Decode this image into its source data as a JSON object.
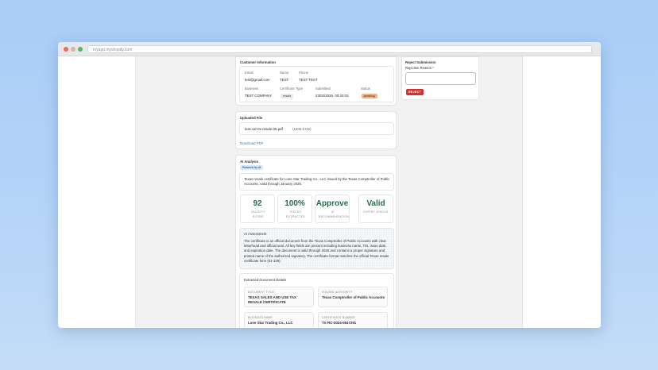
{
  "browser": {
    "url": "myapp.myshopify.com"
  },
  "customer": {
    "title": "Customer Information",
    "email_label": "Email",
    "email": "test@gmail.com",
    "name_label": "Name",
    "name": "TEST",
    "phone_label": "Phone",
    "phone": "TEST TEST",
    "business_label": "Business",
    "business": "TEST COMPANY",
    "cert_type_label": "Certificate Type",
    "cert_type": "resale",
    "submitted_label": "Submitted",
    "submitted": "23/02/2026, 00:43:03",
    "status_label": "Status",
    "status": "pending"
  },
  "file": {
    "title": "Uploaded File",
    "name": "test-cert-tx-resale-05.pdf",
    "size": "(1605.8 KB)",
    "download_label": "Download PDF"
  },
  "ai": {
    "title": "AI Analysis",
    "powered_by": "Powered by AI",
    "summary": "Texas resale certificate for Lone Star Trading Co., LLC issued by the Texas Comptroller of Public Accounts, valid through January 2026.",
    "metrics": [
      {
        "value": "92",
        "label": "VALIDITY SCORE"
      },
      {
        "value": "100%",
        "label": "FIELDS EXTRACTED"
      },
      {
        "value": "Approve",
        "label": "AI RECOMMENDATION"
      },
      {
        "value": "Valid",
        "label": "EXPIRY STATUS"
      }
    ],
    "assessment_title": "AI Assessment",
    "assessment": "The certificate is an official document from the Texas Comptroller of Public Accounts with clear letterhead and official seal. All key fields are present including business name, TIN, issue date, and expiration date. The document is valid through 2026 and contains a proper signature and printed name of the authorized signatory. The certificate format matches the official Texas resale certificate form (01-339).",
    "details_title": "Extracted Document Details",
    "details": [
      {
        "label": "DOCUMENT TITLE",
        "value": "TEXAS SALES AND USE TAX RESALE CERTIFICATE"
      },
      {
        "label": "ISSUING AUTHORITY",
        "value": "Texas Comptroller of Public Accounts"
      },
      {
        "label": "BUSINESS NAME",
        "value": "Lone Star Trading Co., LLC"
      },
      {
        "label": "CERTIFICATE NUMBER",
        "value": "TX-RC-2024-0847291"
      }
    ]
  },
  "reject": {
    "title": "Reject Submission",
    "reason_label": "Rejection Reason *",
    "button_label": "REJECT"
  },
  "colors": {
    "accent_link": "#2f79cf",
    "reject_red": "#d62f2f",
    "metric_green": "#2a6a4a",
    "status_pending": "#f2b38a"
  }
}
